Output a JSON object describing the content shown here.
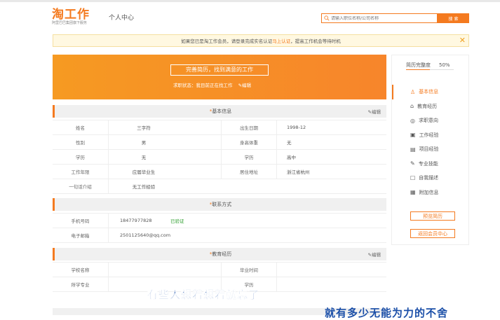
{
  "header": {
    "logo_text": "淘工作",
    "logo_sub": "阿里巴巴集团旗下服务",
    "breadcrumb": "个人中心",
    "search_placeholder": "请输入职位名称/公司名称",
    "search_button": "搜 索"
  },
  "notice": {
    "text_before": "如果您已是淘工作会员，请登录完成实名认证",
    "link": "马上认证",
    "text_after": "，提高工作机会等待时机"
  },
  "banner": {
    "title": "完善简历，找到满意的工作",
    "subtitle": "求职状态：我目前正在找工作",
    "edit": "编辑"
  },
  "basic_info": {
    "heading": "基本信息",
    "edit": "编辑",
    "rows": [
      {
        "l1": "姓名",
        "v1": "三字符",
        "l2": "出生日期",
        "v2": "1998-12"
      },
      {
        "l1": "性别",
        "v1": "男",
        "l2": "身高体重",
        "v2": "无"
      },
      {
        "l1": "学历",
        "v1": "无",
        "l2": "学历",
        "v2": "高中"
      },
      {
        "l1": "工作年限",
        "v1": "应届毕业生",
        "l2": "居住地址",
        "v2": "浙江省杭州"
      },
      {
        "l1": "一句话介绍",
        "v1": "无工作经验",
        "l2": "",
        "v2": ""
      }
    ]
  },
  "contact": {
    "heading": "联系方式",
    "rows": [
      {
        "label": "手机号码",
        "value": "18477977828",
        "tag": "已验证"
      },
      {
        "label": "电子邮箱",
        "value": "2501125640@qq.com",
        "tag": ""
      }
    ]
  },
  "education": {
    "heading": "教育经历",
    "edit": "编辑",
    "rows": [
      {
        "l1": "学校名称",
        "v1": "",
        "l2": "毕业时间",
        "v2": ""
      },
      {
        "l1": "所学专业",
        "v1": "",
        "l2": "学历",
        "v2": ""
      }
    ]
  },
  "sidebar": {
    "progress_label": "简历完整度",
    "progress_value": "50%",
    "progress_fraction": 0.5,
    "items": [
      {
        "label": "基本信息",
        "icon": "user-icon",
        "active": true
      },
      {
        "label": "教育经历",
        "icon": "graduation-cap-icon",
        "active": false
      },
      {
        "label": "求职意向",
        "icon": "target-icon",
        "active": false
      },
      {
        "label": "工作经验",
        "icon": "briefcase-icon",
        "active": false
      },
      {
        "label": "项目经验",
        "icon": "folder-icon",
        "active": false
      },
      {
        "label": "专业技能",
        "icon": "pencil-icon",
        "active": false
      },
      {
        "label": "自我描述",
        "icon": "document-icon",
        "active": false
      },
      {
        "label": "附加信息",
        "icon": "attachment-icon",
        "active": false
      }
    ],
    "buttons": [
      "预览简历",
      "返回会员中心"
    ]
  },
  "subtitles": {
    "line1": "有些人想着想着就忘了",
    "line2": "就有多少无能为力的不舍"
  },
  "colors": {
    "accent": "#f47a1f",
    "subtitle": "#1b4fa8"
  }
}
